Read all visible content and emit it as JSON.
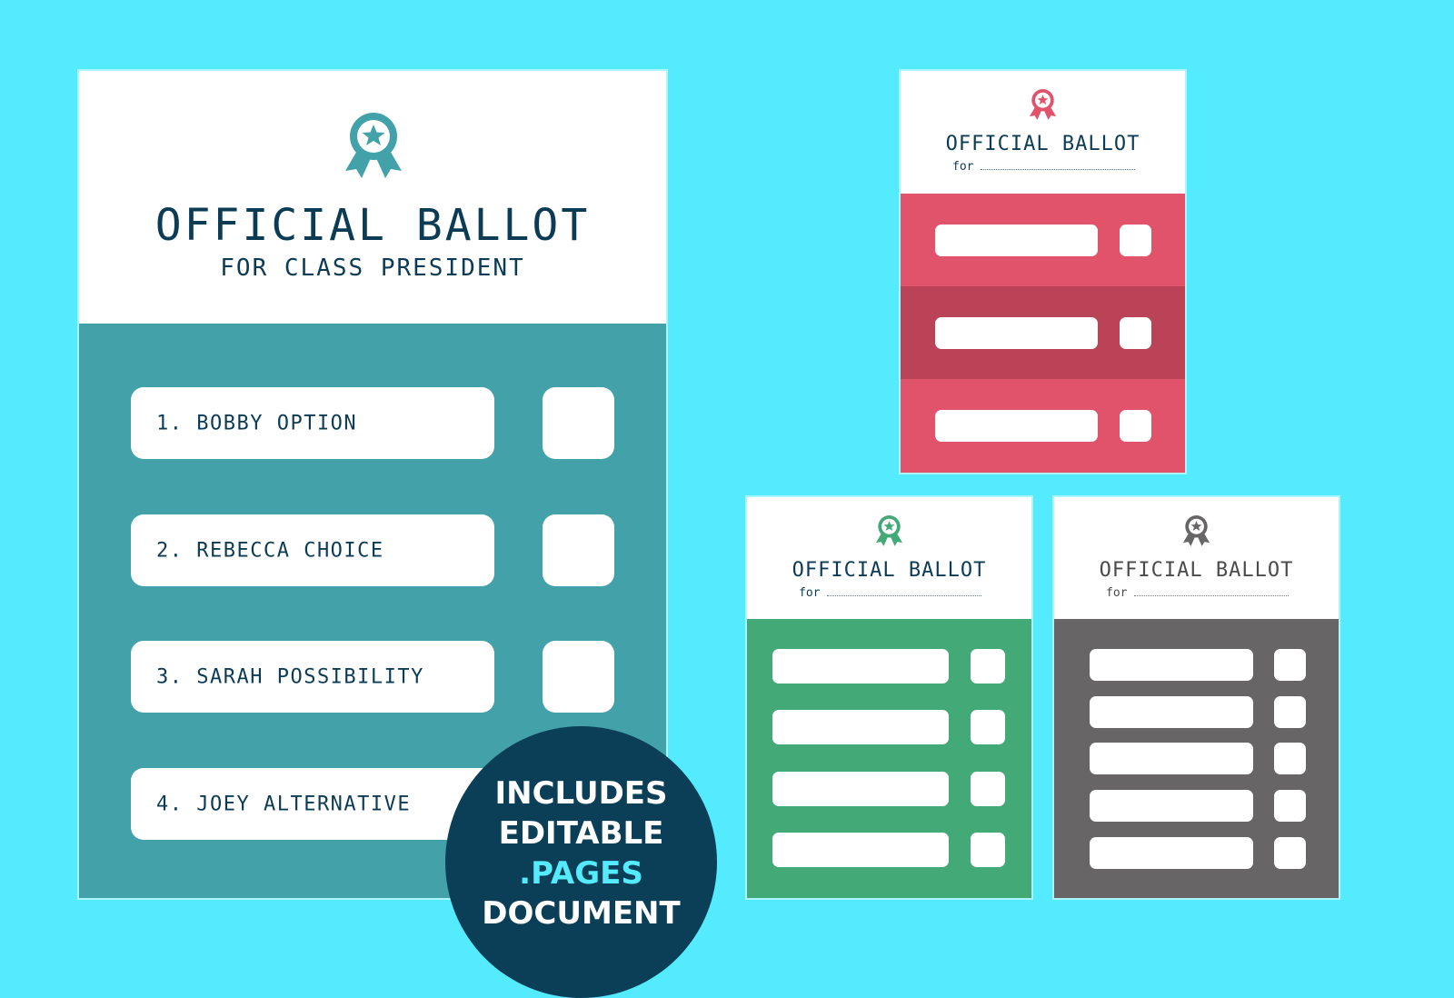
{
  "colors": {
    "background": "#55ebfe",
    "navy_text": "#0c3b55",
    "teal": "#43a1aa",
    "red": "#e0536a",
    "red_dark": "#bb4357",
    "green": "#43aa77",
    "gray": "#676565",
    "badge_bg": "#0b3e57"
  },
  "main_ballot": {
    "icon": "award-ribbon-icon",
    "title": "OFFICIAL BALLOT",
    "subtitle": "FOR CLASS PRESIDENT",
    "candidates": [
      {
        "label": "1. BOBBY OPTION"
      },
      {
        "label": "2. REBECCA CHOICE"
      },
      {
        "label": "3. SARAH POSSIBILITY"
      },
      {
        "label": "4. JOEY ALTERNATIVE"
      }
    ]
  },
  "variants": [
    {
      "name": "red",
      "icon": "award-ribbon-icon",
      "title": "OFFICIAL BALLOT",
      "for_label": "for",
      "rows": 3
    },
    {
      "name": "green",
      "icon": "award-ribbon-icon",
      "title": "OFFICIAL BALLOT",
      "for_label": "for",
      "rows": 4
    },
    {
      "name": "gray",
      "icon": "award-ribbon-icon",
      "title": "OFFICIAL BALLOT",
      "for_label": "for",
      "rows": 5
    }
  ],
  "badge": {
    "lines": [
      "INCLUDES",
      "EDITABLE",
      ".PAGES",
      "DOCUMENT"
    ]
  }
}
